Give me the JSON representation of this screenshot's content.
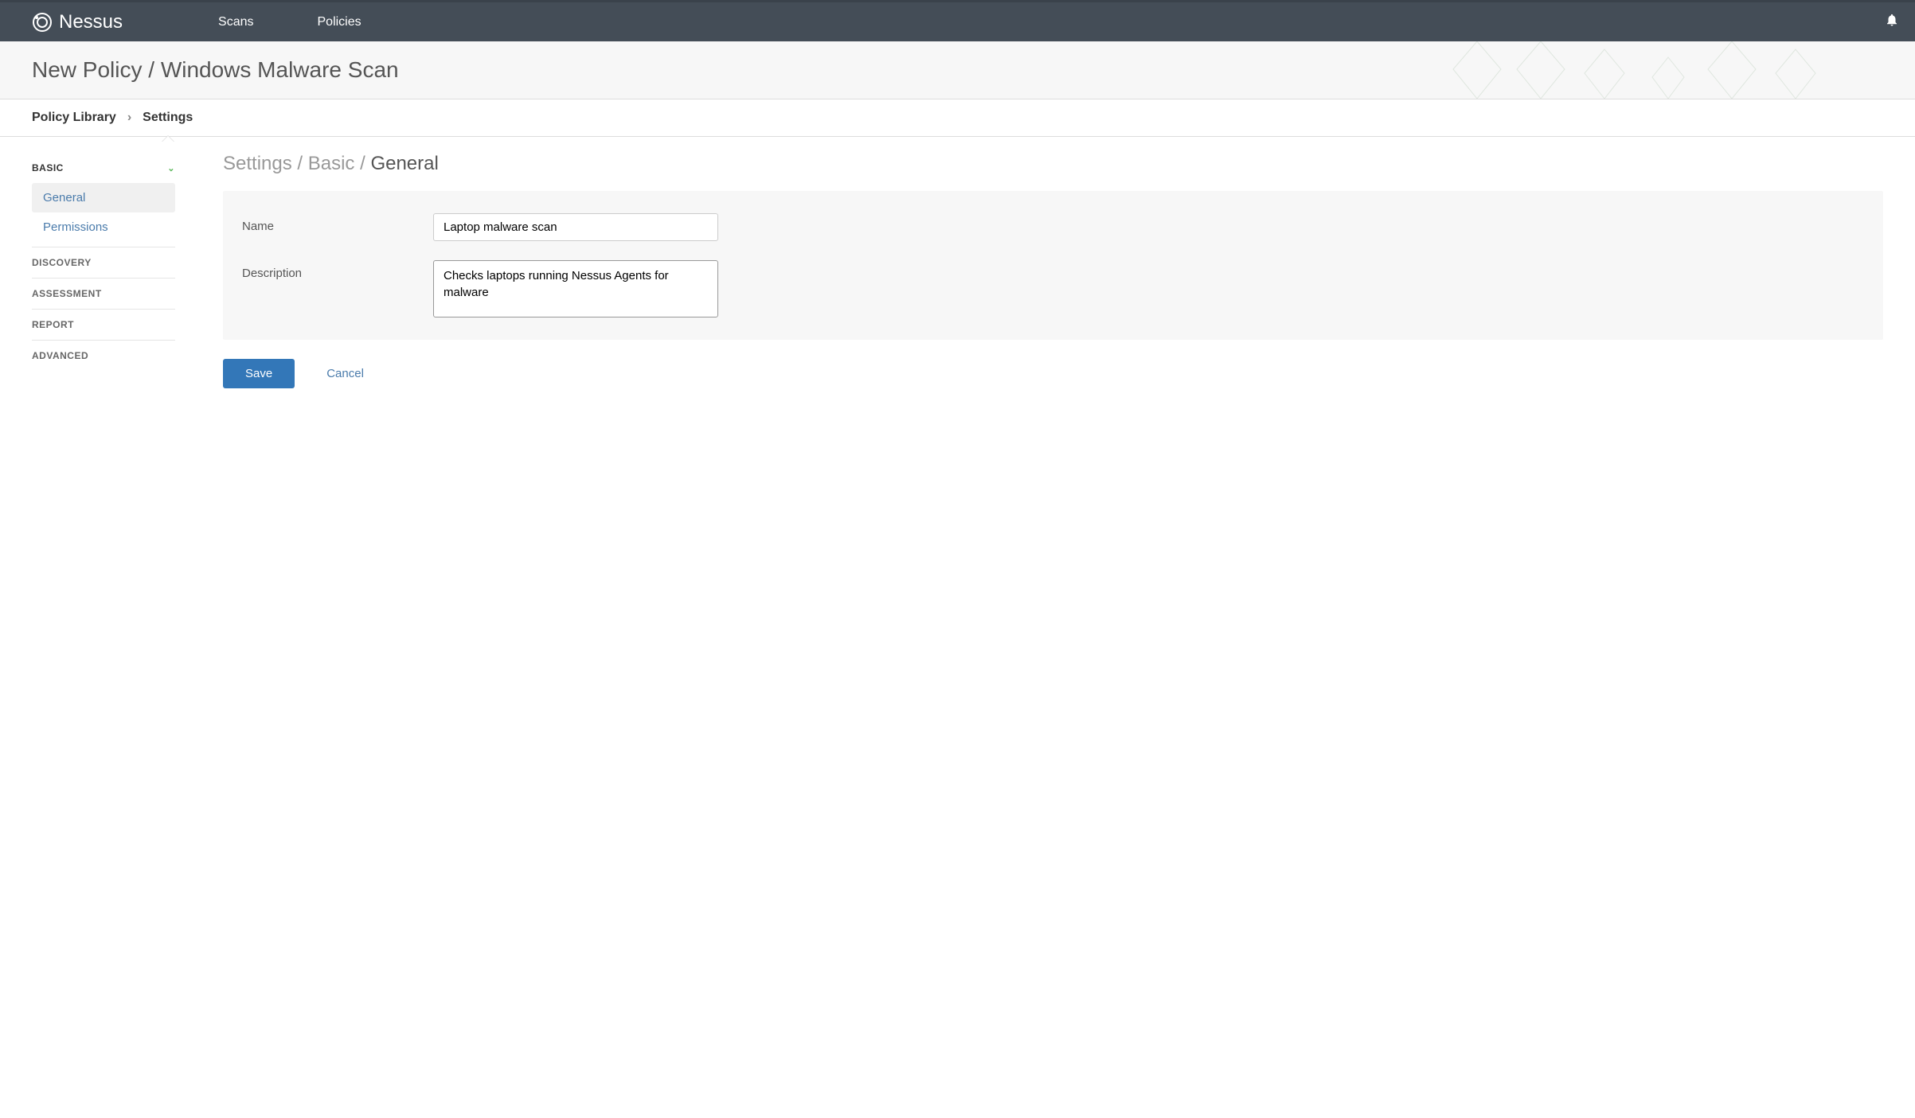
{
  "app": {
    "name": "Nessus"
  },
  "nav": {
    "scans": "Scans",
    "policies": "Policies"
  },
  "page": {
    "title": "New Policy / Windows Malware Scan"
  },
  "breadcrumb": {
    "policy_library": "Policy Library",
    "settings": "Settings"
  },
  "sidebar": {
    "basic": {
      "label": "BASIC",
      "general": "General",
      "permissions": "Permissions"
    },
    "discovery": "DISCOVERY",
    "assessment": "ASSESSMENT",
    "report": "REPORT",
    "advanced": "ADVANCED"
  },
  "panel": {
    "crumb_settings": "Settings",
    "crumb_basic": "Basic",
    "crumb_general": "General"
  },
  "form": {
    "name_label": "Name",
    "name_value": "Laptop malware scan",
    "description_label": "Description",
    "description_value": "Checks laptops running Nessus Agents for malware"
  },
  "actions": {
    "save": "Save",
    "cancel": "Cancel"
  }
}
